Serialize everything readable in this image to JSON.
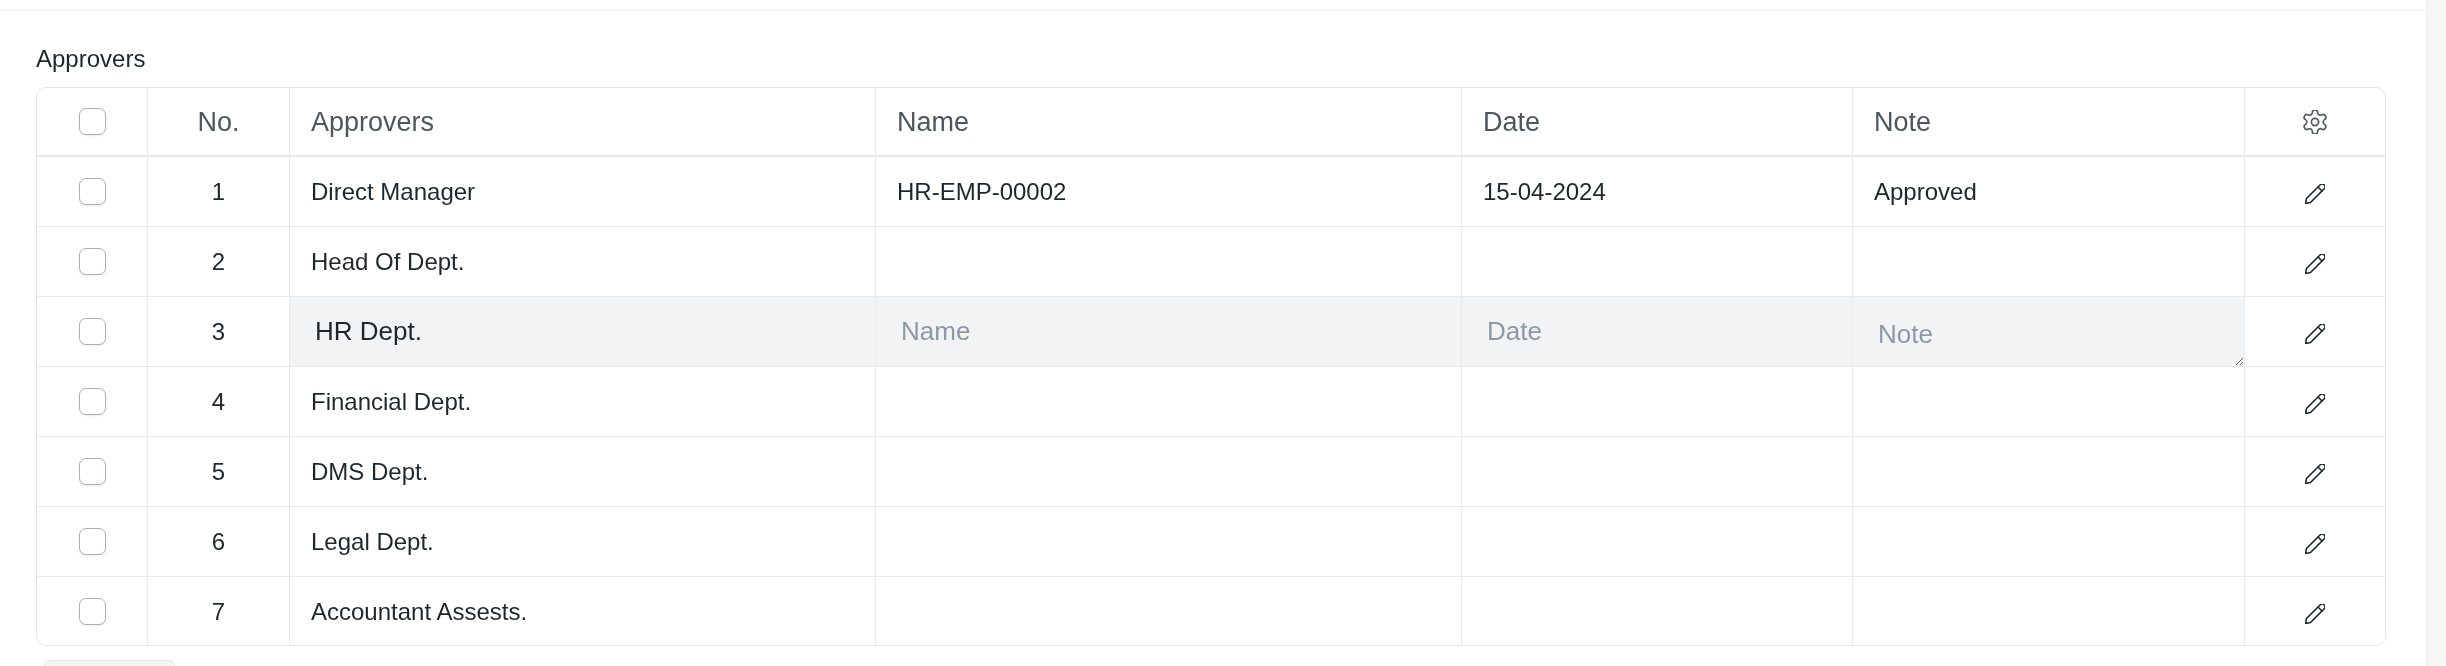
{
  "section": {
    "title": "Approvers"
  },
  "table": {
    "select_all": {
      "checked": false
    },
    "columns": [
      {
        "label": "No."
      },
      {
        "label": "Approvers"
      },
      {
        "label": "Name"
      },
      {
        "label": "Date"
      },
      {
        "label": "Note"
      }
    ],
    "rows": [
      {
        "checked": false,
        "no": "1",
        "approver": "Direct Manager",
        "editing": false,
        "name": "HR-EMP-00002",
        "date": "15-04-2024",
        "note": "Approved"
      },
      {
        "checked": false,
        "no": "2",
        "approver": "Head Of Dept.",
        "editing": false
      },
      {
        "checked": false,
        "no": "3",
        "approver": "HR Dept.",
        "editing": true,
        "name_field": {
          "placeholder": "Name"
        },
        "date_field": {
          "placeholder": "Date"
        },
        "note_field": {
          "placeholder": "Note"
        }
      },
      {
        "checked": false,
        "no": "4",
        "approver": "Financial Dept.",
        "editing": false
      },
      {
        "checked": false,
        "no": "5",
        "approver": "DMS Dept.",
        "editing": false
      },
      {
        "checked": false,
        "no": "6",
        "approver": "Legal Dept.",
        "editing": false
      },
      {
        "checked": false,
        "no": "7",
        "approver": "Accountant Assests.",
        "editing": false
      }
    ]
  }
}
